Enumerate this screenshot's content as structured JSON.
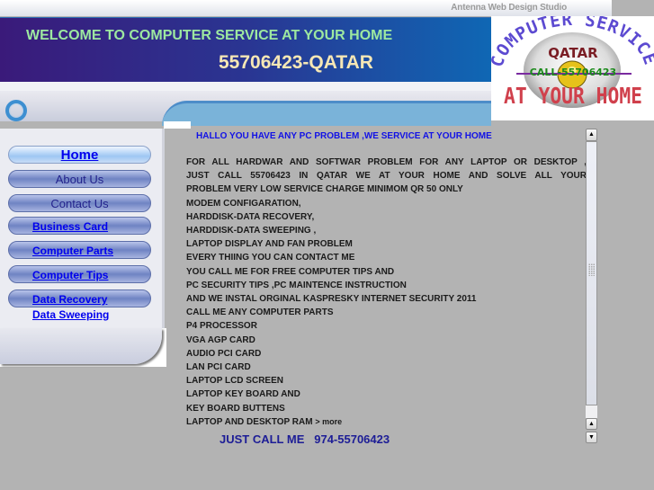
{
  "header": {
    "studio_credit": "Antenna Web Design Studio",
    "welcome": "WELCOME TO COMPUTER SERVICE  AT YOUR HOME",
    "phone": "55706423-QATAR"
  },
  "logo": {
    "arc_text": "COMPUTER SERVICE",
    "country": "QATAR",
    "call": "CALL-55706423",
    "tagline": "AT YOUR HOME"
  },
  "sidebar": {
    "items": [
      {
        "label": "Home",
        "active": true
      },
      {
        "label": "About Us"
      },
      {
        "label": "Contact Us"
      },
      {
        "label": "Business Card"
      },
      {
        "label": "Computer Parts"
      },
      {
        "label": "Computer Tips"
      },
      {
        "label": "Data Recovery"
      },
      {
        "label": "Data Sweeping"
      }
    ]
  },
  "content": {
    "headline": "HALLO YOU HAVE ANY PC PROBLEM ,WE SERVICE AT YOUR HOME",
    "lines": [
      "FOR ALL HARDWAR AND SOFTWAR PROBLEM FOR ANY LAPTOP OR DESKTOP ,",
      "JUST CALL 55706423 IN QATAR WE AT YOUR HOME AND SOLVE ALL YOUR",
      "PROBLEM VERY LOW SERVICE CHARGE MINIMOM QR 50 ONLY",
      "MODEM CONFIGARATION,",
      "HARDDISK-DATA RECOVERY,",
      "HARDDISK-DATA SWEEPING ,",
      "LAPTOP DISPLAY AND FAN PROBLEM",
      "EVERY THIING YOU CAN CONTACT ME",
      "YOU CALL ME FOR FREE COMPUTER TIPS  AND",
      "PC SECURITY TIPS ,PC MAINTENCE  INSTRUCTION",
      "AND WE INSTAL ORGINAL KASPRESKY INTERNET SECURITY 2011",
      "CALL ME ANY COMPUTER PARTS",
      "P4 PROCESSOR",
      "VGA AGP  CARD",
      "AUDIO PCI CARD",
      "LAN PCI CARD",
      "LAPTOP LCD SCREEN",
      "LAPTOP KEY BOARD AND",
      "KEY BOARD BUTTENS",
      "LAPTOP AND DESKTOP RAM"
    ],
    "more_link": "> more",
    "call_label": "JUST CALL ME",
    "call_number": "974-55706423"
  },
  "scrollbar": {
    "up_glyph": "▲",
    "down_glyph": "▼"
  }
}
